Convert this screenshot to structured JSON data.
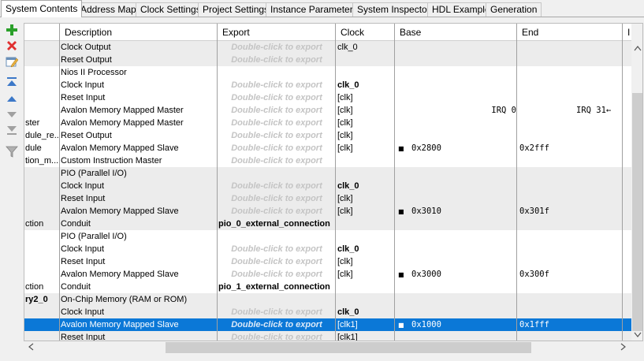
{
  "tabs": [
    {
      "label": "System Contents",
      "active": true
    },
    {
      "label": "Address Map",
      "active": false
    },
    {
      "label": "Clock Settings",
      "active": false
    },
    {
      "label": "Project Settings",
      "active": false
    },
    {
      "label": "Instance Parameters",
      "active": false
    },
    {
      "label": "System Inspector",
      "active": false
    },
    {
      "label": "HDL Example",
      "active": false
    },
    {
      "label": "Generation",
      "active": false
    }
  ],
  "toolbar": {
    "icons": [
      "add-icon",
      "remove-icon",
      "edit-icon",
      "move-to-top-icon",
      "move-up-icon",
      "move-down-icon",
      "move-to-bottom-icon",
      "filter-icon"
    ],
    "colors": {
      "add": "#2aa02a",
      "remove": "#e03030",
      "arrows": "#3c78c8",
      "arrows_disabled": "#a0a0a0"
    }
  },
  "grid": {
    "columns": {
      "description": "Description",
      "export": "Export",
      "clock": "Clock",
      "base": "Base",
      "end": "End",
      "irq": "I"
    },
    "rows": [
      {
        "name": "",
        "description": "Clock Output",
        "export": "Double-click to export",
        "clock": "clk_0",
        "grey": true
      },
      {
        "name": "",
        "description": "Reset Output",
        "export": "Double-click to export",
        "clock": "",
        "grey": true
      },
      {
        "name": "",
        "description": "Nios II Processor",
        "export": "",
        "clock": ""
      },
      {
        "name": "",
        "description": "Clock Input",
        "export": "Double-click to export",
        "clock": "clk_0",
        "clock_bold": true
      },
      {
        "name": "",
        "description": "Reset Input",
        "export": "Double-click to export",
        "clock": "[clk]"
      },
      {
        "name": "",
        "description": "Avalon Memory Mapped Master",
        "export": "Double-click to export",
        "clock": "[clk]",
        "irq_from": "IRQ 0",
        "irq_to": "IRQ 31",
        "irq_arrow": "←"
      },
      {
        "name": "ster",
        "description": "Avalon Memory Mapped Master",
        "export": "Double-click to export",
        "clock": "[clk]"
      },
      {
        "name": "dule_re...",
        "description": "Reset Output",
        "export": "Double-click to export",
        "clock": "[clk]"
      },
      {
        "name": "dule",
        "description": "Avalon Memory Mapped Slave",
        "export": "Double-click to export",
        "clock": "[clk]",
        "base": "0x2800",
        "end": "0x2fff",
        "locked": true
      },
      {
        "name": "tion_m...",
        "description": "Custom Instruction Master",
        "export": "Double-click to export",
        "clock": ""
      },
      {
        "name": "",
        "description": "PIO (Parallel I/O)",
        "export": "",
        "clock": "",
        "grey": true
      },
      {
        "name": "",
        "description": "Clock Input",
        "export": "Double-click to export",
        "clock": "clk_0",
        "clock_bold": true,
        "grey": true
      },
      {
        "name": "",
        "description": "Reset Input",
        "export": "Double-click to export",
        "clock": "[clk]",
        "grey": true
      },
      {
        "name": "",
        "description": "Avalon Memory Mapped Slave",
        "export": "Double-click to export",
        "clock": "[clk]",
        "base": "0x3010",
        "end": "0x301f",
        "locked": true,
        "grey": true
      },
      {
        "name": "ction",
        "description": "Conduit",
        "export": "pio_0_external_connection",
        "export_set": true,
        "clock": "",
        "grey": true
      },
      {
        "name": "",
        "description": "PIO (Parallel I/O)",
        "export": "",
        "clock": ""
      },
      {
        "name": "",
        "description": "Clock Input",
        "export": "Double-click to export",
        "clock": "clk_0",
        "clock_bold": true
      },
      {
        "name": "",
        "description": "Reset Input",
        "export": "Double-click to export",
        "clock": "[clk]"
      },
      {
        "name": "",
        "description": "Avalon Memory Mapped Slave",
        "export": "Double-click to export",
        "clock": "[clk]",
        "base": "0x3000",
        "end": "0x300f",
        "locked": true
      },
      {
        "name": "ction",
        "description": "Conduit",
        "export": "pio_1_external_connection",
        "export_set": true,
        "clock": ""
      },
      {
        "name": "ry2_0",
        "name_bold": true,
        "description": "On-Chip Memory (RAM or ROM)",
        "export": "",
        "clock": "",
        "grey": true
      },
      {
        "name": "",
        "description": "Clock Input",
        "export": "Double-click to export",
        "clock": "clk_0",
        "clock_bold": true,
        "grey": true
      },
      {
        "name": "",
        "description": "Avalon Memory Mapped Slave",
        "export": "Double-click to export",
        "clock": "[clk1]",
        "base": "0x1000",
        "end": "0x1fff",
        "locked": true,
        "selected": true
      },
      {
        "name": "",
        "description": "Reset Input",
        "export": "Double-click to export",
        "clock": "[clk1]",
        "grey": true
      }
    ]
  },
  "scroll": {
    "up": "^",
    "down": "v",
    "left": "<",
    "right": ">"
  },
  "lock_glyph": "■"
}
